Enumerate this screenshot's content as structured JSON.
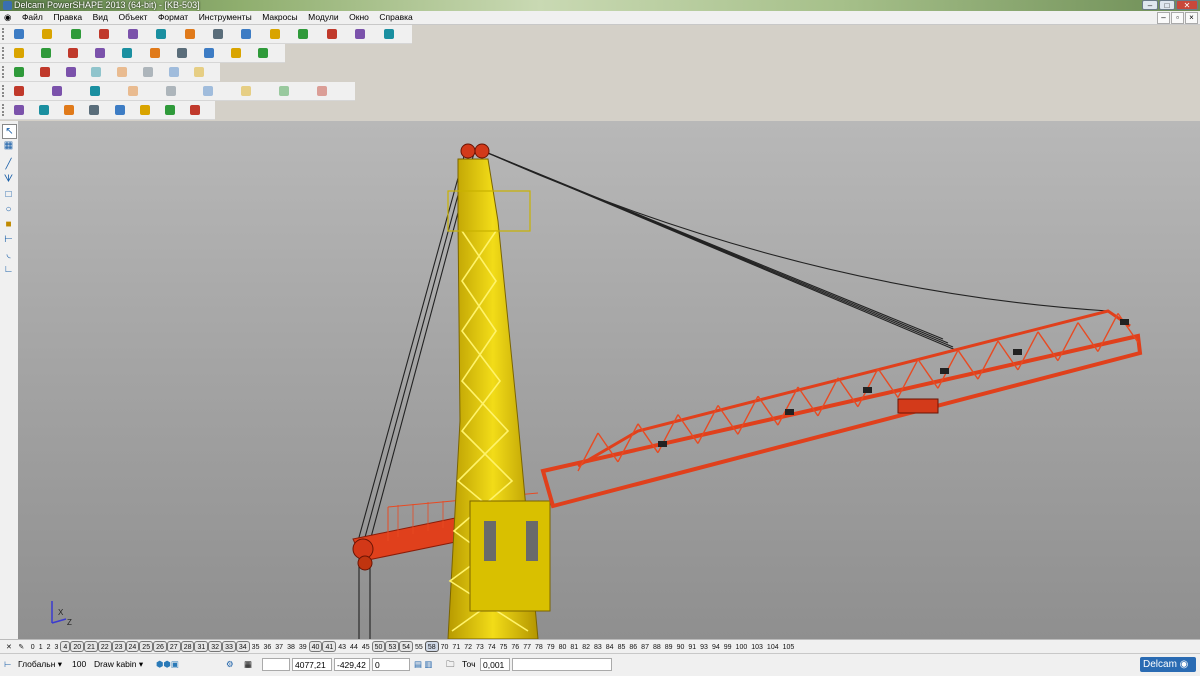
{
  "window": {
    "title": "Delcam PowerSHAPE 2013 (64-bit) - [KB-503]",
    "buttons": [
      "–",
      "□",
      "✕"
    ],
    "mdi_buttons": [
      "–",
      "▫",
      "×"
    ]
  },
  "menu": [
    "Файл",
    "Правка",
    "Вид",
    "Объект",
    "Формат",
    "Инструменты",
    "Макросы",
    "Модули",
    "Окно",
    "Справка"
  ],
  "toolbars": [
    {
      "name": "main-toolbar",
      "icons": [
        "new-icon",
        "open-icon",
        "save-icon",
        "print-icon",
        "cut-icon",
        "copy-icon",
        "paste-icon",
        "undo-icon",
        "redo-icon",
        "select-icon",
        "measure-icon",
        "circle-icon",
        "line-icon",
        "wizard-icon"
      ]
    },
    {
      "name": "view-toolbar",
      "icons": [
        "view-top-icon",
        "view-front-icon",
        "view-iso-icon",
        "zoom-in-icon",
        "zoom-out-icon",
        "zoom-window-icon",
        "pan-icon",
        "rotate-icon",
        "shade-icon",
        "wireframe-icon"
      ]
    },
    {
      "name": "object-toolbar",
      "icons": [
        "level-icon",
        "layer-icon",
        "color-icon",
        "material-icon",
        "render-icon",
        "light-icon",
        "texture-icon",
        "group-icon"
      ]
    },
    {
      "name": "solid-toolbar",
      "icons": [
        "solid-icon",
        "surface-icon",
        "extrude-icon",
        "revolve-icon",
        "boolean-icon",
        "fillet-icon",
        "chamfer-icon",
        "shell-icon",
        "blend-icon"
      ]
    },
    {
      "name": "workplane-toolbar",
      "icons": [
        "workplane-icon",
        "axis-icon",
        "ucs-icon",
        "grid-icon",
        "snap-icon",
        "dim-icon",
        "text-icon",
        "hatch-icon"
      ]
    }
  ],
  "sidebar_tools": [
    "select-tool-icon",
    "assembly-icon",
    "line-tool-icon",
    "polyline-tool-icon",
    "rectangle-tool-icon",
    "circle-tool-icon",
    "solid-tool-icon",
    "workplane-tool-icon",
    "arc-tool-icon",
    "dimension-tool-icon"
  ],
  "levels": [
    {
      "n": "0"
    },
    {
      "n": "1"
    },
    {
      "n": "2"
    },
    {
      "n": "3"
    },
    {
      "n": "4",
      "on": true
    },
    {
      "n": "20",
      "on": true
    },
    {
      "n": "21",
      "on": true
    },
    {
      "n": "22",
      "on": true
    },
    {
      "n": "23",
      "on": true
    },
    {
      "n": "24",
      "on": true
    },
    {
      "n": "25",
      "on": true
    },
    {
      "n": "26",
      "on": true
    },
    {
      "n": "27",
      "on": true
    },
    {
      "n": "28",
      "on": true
    },
    {
      "n": "31",
      "on": true
    },
    {
      "n": "32",
      "on": true
    },
    {
      "n": "33",
      "on": true
    },
    {
      "n": "34",
      "on": true
    },
    {
      "n": "35"
    },
    {
      "n": "36"
    },
    {
      "n": "37"
    },
    {
      "n": "38"
    },
    {
      "n": "39"
    },
    {
      "n": "40",
      "on": true
    },
    {
      "n": "41",
      "on": true
    },
    {
      "n": "43"
    },
    {
      "n": "44"
    },
    {
      "n": "45"
    },
    {
      "n": "50",
      "on": true
    },
    {
      "n": "53",
      "on": true
    },
    {
      "n": "54",
      "on": true
    },
    {
      "n": "55"
    },
    {
      "n": "58",
      "sel": true
    },
    {
      "n": "70"
    },
    {
      "n": "71"
    },
    {
      "n": "72"
    },
    {
      "n": "73"
    },
    {
      "n": "74"
    },
    {
      "n": "75"
    },
    {
      "n": "76"
    },
    {
      "n": "77"
    },
    {
      "n": "78"
    },
    {
      "n": "79"
    },
    {
      "n": "80"
    },
    {
      "n": "81"
    },
    {
      "n": "82"
    },
    {
      "n": "83"
    },
    {
      "n": "84"
    },
    {
      "n": "85"
    },
    {
      "n": "86"
    },
    {
      "n": "87"
    },
    {
      "n": "88"
    },
    {
      "n": "89"
    },
    {
      "n": "90"
    },
    {
      "n": "91"
    },
    {
      "n": "93"
    },
    {
      "n": "94"
    },
    {
      "n": "99"
    },
    {
      "n": "100"
    },
    {
      "n": "103"
    },
    {
      "n": "104"
    },
    {
      "n": "105"
    }
  ],
  "status": {
    "workplane": "Глобальн",
    "level_num": "100",
    "level_name": "Draw kabin",
    "x": "4077,21",
    "y": "-429,42",
    "z": "0",
    "snap_label": "Точ",
    "tolerance": "0,001",
    "brand": "Delcam"
  },
  "viewport": {
    "background": "#a9a9a9",
    "mast_color": "#e8d000",
    "jib_color": "#e03a1a",
    "triad_label": "X Z",
    "axis_x": "X",
    "axis_z": "Z"
  }
}
